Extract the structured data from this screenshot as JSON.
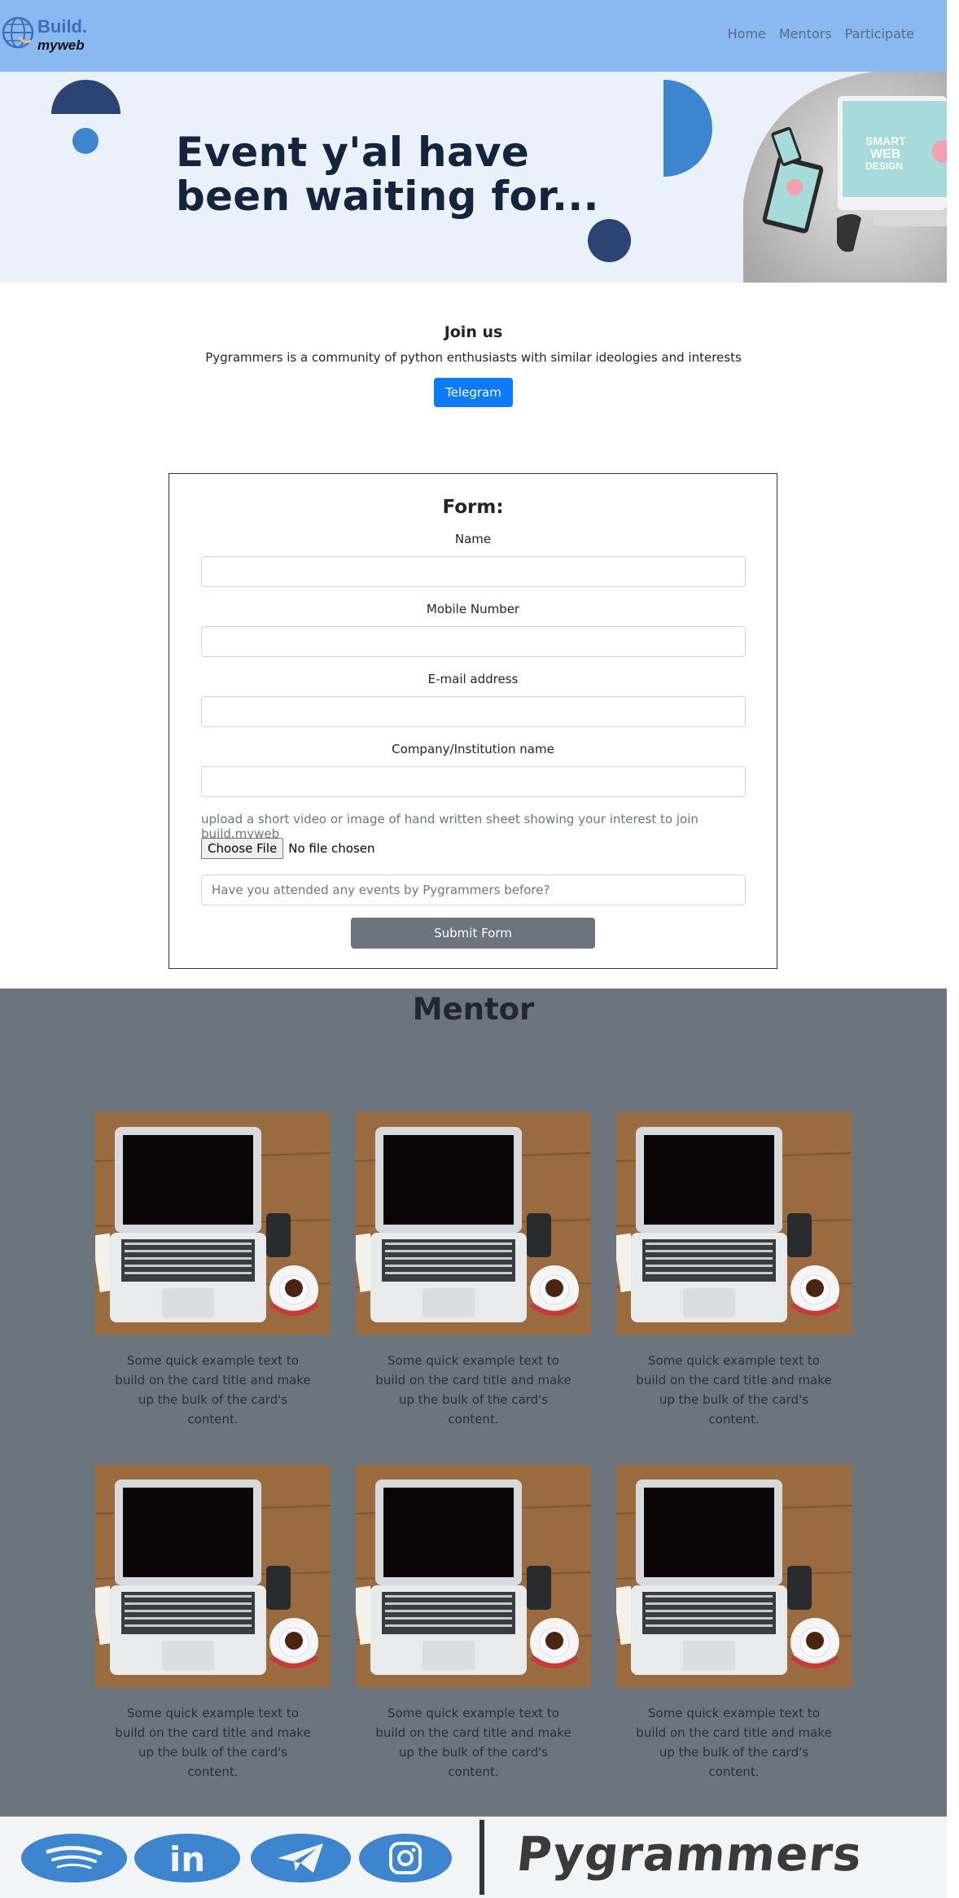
{
  "navbar": {
    "logo_primary": "Build.",
    "logo_secondary": "myweb",
    "links": [
      "Home",
      "Mentors",
      "Participate"
    ]
  },
  "hero": {
    "title_line1": "Event y'al have",
    "title_line2": "been waiting for...",
    "image_screen_text_1": "SMART",
    "image_screen_text_2": "WEB",
    "image_screen_text_3": "DESIGN"
  },
  "join": {
    "title": "Join us",
    "text": "Pygrammers is a community of python enthusiasts with similar ideologies and interests",
    "button": "Telegram"
  },
  "form": {
    "title": "Form:",
    "fields": [
      {
        "label": "Name",
        "value": ""
      },
      {
        "label": "Mobile Number",
        "value": ""
      },
      {
        "label": "E-mail address",
        "value": ""
      },
      {
        "label": "Company/Institution name",
        "value": ""
      }
    ],
    "upload_text": "upload a short video or image of hand written sheet showing your interest to join build.myweb",
    "file_button": "Choose File",
    "file_status": "No file chosen",
    "attended_placeholder": "Have you attended any events by Pygrammers before?",
    "submit": "Submit Form"
  },
  "mentor": {
    "title": "Mentor",
    "cards": [
      {
        "text": "Some quick example text to build on the card title and make up the bulk of the card's content."
      },
      {
        "text": "Some quick example text to build on the card title and make up the bulk of the card's content."
      },
      {
        "text": "Some quick example text to build on the card title and make up the bulk of the card's content."
      },
      {
        "text": "Some quick example text to build on the card title and make up the bulk of the card's content."
      },
      {
        "text": "Some quick example text to build on the card title and make up the bulk of the card's content."
      },
      {
        "text": "Some quick example text to build on the card title and make up the bulk of the card's content."
      }
    ]
  },
  "footer": {
    "icons": [
      "spotify-icon",
      "linkedin-icon",
      "telegram-icon",
      "instagram-icon"
    ],
    "brand": "Pygrammers"
  },
  "colors": {
    "navbar": "#8ab9f1",
    "hero_bg": "#eaf1fa",
    "primary_button": "#0d7bf7",
    "mentor_bg": "#6c757d",
    "accent_blue": "#3d85cf",
    "dark_navy": "#2b4474"
  }
}
